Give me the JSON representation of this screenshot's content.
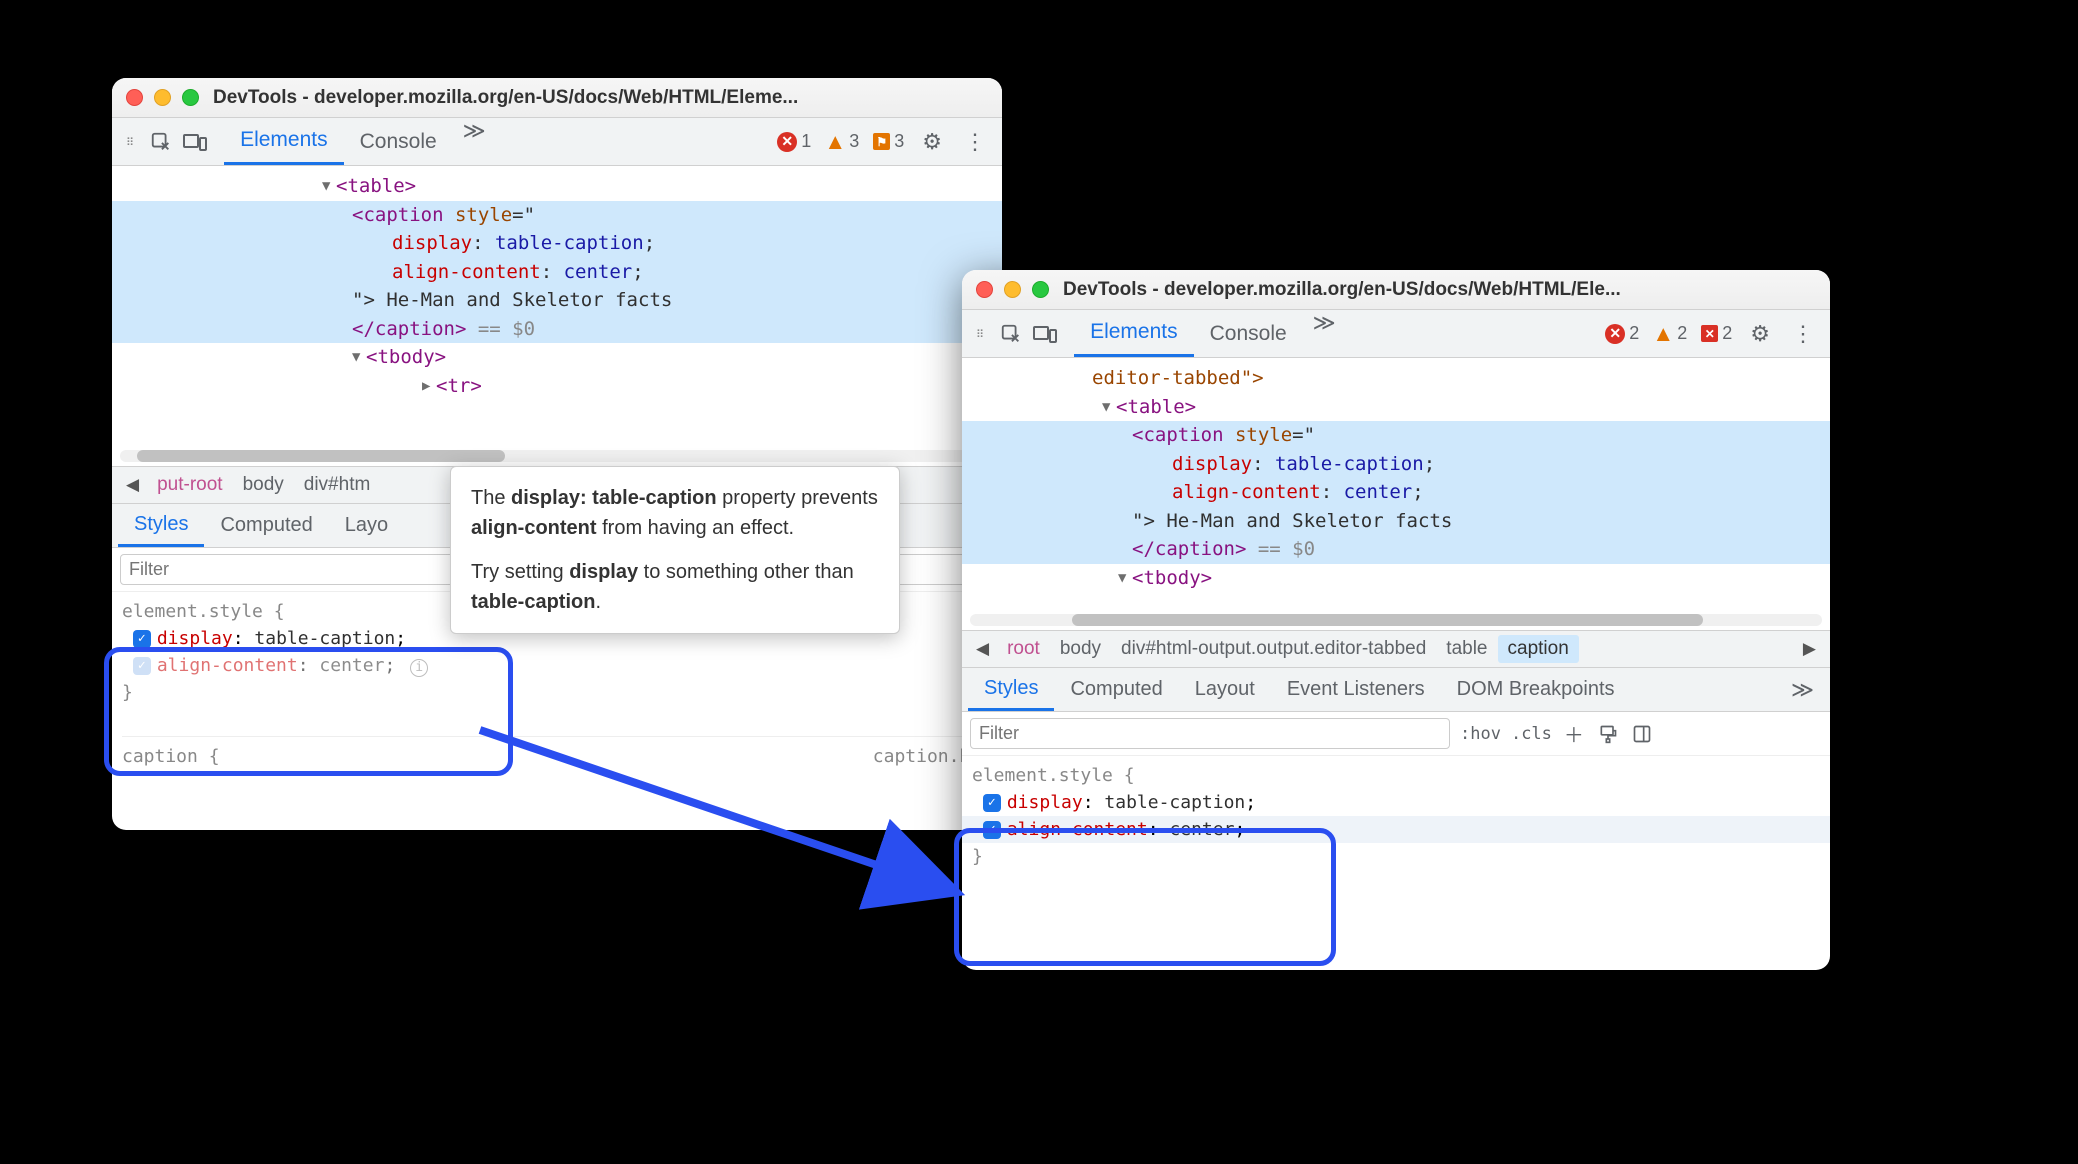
{
  "window1": {
    "title": "DevTools - developer.mozilla.org/en-US/docs/Web/HTML/Eleme...",
    "tabs": {
      "elements": "Elements",
      "console": "Console"
    },
    "badges": {
      "errors": "1",
      "warnings": "3",
      "flags": "3"
    },
    "dom": {
      "table_open": "<table>",
      "caption_open": "<caption",
      "style_attr": "style",
      "eq_quote": "=\"",
      "disp_prop": "display",
      "disp_val": "table-caption",
      "align_prop": "align-content",
      "align_val": "center",
      "close_quote_gt": "\">",
      "caption_text": "He-Man and Skeletor facts",
      "caption_close": "</caption>",
      "eq_dollar": "== $0",
      "tbody_open": "<tbody>",
      "tr_open": "<tr>"
    },
    "breadcrumb": {
      "put_root": "put-root",
      "body": "body",
      "divhtml": "div#htm"
    },
    "sidetabs": {
      "styles": "Styles",
      "computed": "Computed",
      "layout": "Layo"
    },
    "filter_placeholder": "Filter",
    "styles": {
      "selector": "element.style {",
      "prop1": "display",
      "val1": "table-caption",
      "prop2": "align-content",
      "val2": "center",
      "close": "}",
      "cap_open": "caption {",
      "cap_source": "caption.htm"
    }
  },
  "tooltip": {
    "line1_a": "The ",
    "line1_b": "display: table-caption",
    "line1_c": " property prevents ",
    "line1_d": "align-content",
    "line1_e": " from having an effect.",
    "line2_a": "Try setting ",
    "line2_b": "display",
    "line2_c": " to something other than ",
    "line2_d": "table-caption",
    "line2_e": "."
  },
  "window2": {
    "title": "DevTools - developer.mozilla.org/en-US/docs/Web/HTML/Ele...",
    "tabs": {
      "elements": "Elements",
      "console": "Console"
    },
    "badges": {
      "errors": "2",
      "warnings": "2",
      "violations": "2"
    },
    "dom": {
      "editor_tabbed": "editor-tabbed\">",
      "table_open": "<table>",
      "caption_open": "<caption",
      "style_attr": "style",
      "eq_quote": "=\"",
      "disp_prop": "display",
      "disp_val": "table-caption",
      "align_prop": "align-content",
      "align_val": "center",
      "close_quote_gt": "\">",
      "caption_text": "He-Man and Skeletor facts",
      "caption_close": "</caption>",
      "eq_dollar": "== $0",
      "tbody_open": "<tbody>"
    },
    "breadcrumb": {
      "root": "root",
      "body": "body",
      "divout": "div#html-output.output.editor-tabbed",
      "table": "table",
      "caption": "caption"
    },
    "sidetabs": {
      "styles": "Styles",
      "computed": "Computed",
      "layout": "Layout",
      "event": "Event Listeners",
      "dombp": "DOM Breakpoints"
    },
    "filter_placeholder": "Filter",
    "filter_opts": {
      "hov": ":hov",
      "cls": ".cls"
    },
    "styles": {
      "selector": "element.style {",
      "prop1": "display",
      "val1": "table-caption",
      "prop2": "align-content",
      "val2": "center",
      "close": "}"
    }
  }
}
